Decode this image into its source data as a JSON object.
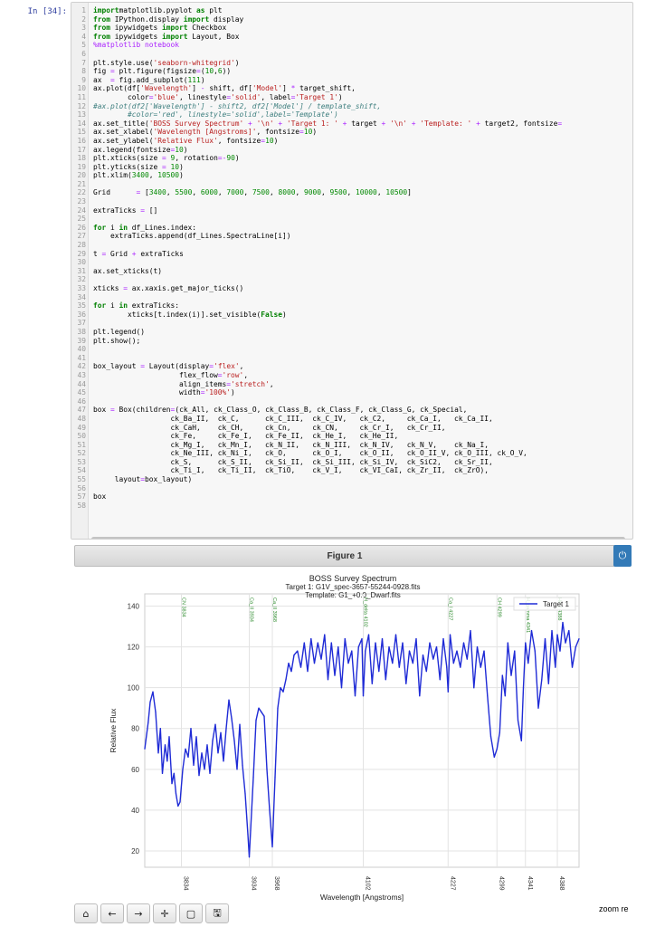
{
  "cell": {
    "prompt": "In [34]:",
    "lines": [
      [
        [
          "kw",
          "import"
        ],
        [
          "",
          "matplotlib.pyplot "
        ],
        [
          "kw",
          "as"
        ],
        [
          "",
          " plt"
        ]
      ],
      [
        [
          "kw",
          "from"
        ],
        [
          "",
          " IPython.display "
        ],
        [
          "kw",
          "import"
        ],
        [
          "",
          " display"
        ]
      ],
      [
        [
          "kw",
          "from"
        ],
        [
          "",
          " ipywidgets "
        ],
        [
          "kw",
          "import"
        ],
        [
          "",
          " Checkbox"
        ]
      ],
      [
        [
          "kw",
          "from"
        ],
        [
          "",
          " ipywidgets "
        ],
        [
          "kw",
          "import"
        ],
        [
          "",
          " Layout, Box"
        ]
      ],
      [
        [
          "op",
          "%matplotlib notebook"
        ]
      ],
      [
        [
          "",
          ""
        ]
      ],
      [
        [
          "",
          "plt.style.use("
        ],
        [
          "str",
          "'seaborn-whitegrid'"
        ],
        [
          "",
          ")"
        ]
      ],
      [
        [
          "",
          "fig "
        ],
        [
          "op",
          "="
        ],
        [
          "",
          " plt.figure(figsize"
        ],
        [
          "op",
          "="
        ],
        [
          "",
          "("
        ],
        [
          "num",
          "10"
        ],
        [
          "",
          ","
        ],
        [
          "num",
          "6"
        ],
        [
          "",
          "))"
        ]
      ],
      [
        [
          "",
          "ax  "
        ],
        [
          "op",
          "="
        ],
        [
          "",
          " fig.add_subplot("
        ],
        [
          "num",
          "111"
        ],
        [
          "",
          ")"
        ]
      ],
      [
        [
          "",
          "ax.plot(df["
        ],
        [
          "str",
          "'Wavelength'"
        ],
        [
          "",
          "] "
        ],
        [
          "op",
          "-"
        ],
        [
          "",
          " shift, df["
        ],
        [
          "str",
          "'Model'"
        ],
        [
          "",
          "] "
        ],
        [
          "op",
          "*"
        ],
        [
          "",
          " target_shift,"
        ]
      ],
      [
        [
          "",
          "        color"
        ],
        [
          "op",
          "="
        ],
        [
          "str",
          "'blue'"
        ],
        [
          "",
          ", linestyle"
        ],
        [
          "op",
          "="
        ],
        [
          "str",
          "'solid'"
        ],
        [
          "",
          ", label"
        ],
        [
          "op",
          "="
        ],
        [
          "str",
          "'Target 1'"
        ],
        [
          "",
          ")"
        ]
      ],
      [
        [
          "cm",
          "#ax.plot(df2['Wavelength'] - shift2, df2['Model'] / template_shift,"
        ]
      ],
      [
        [
          "cm",
          "        #color='red', linestyle='solid',label='Template')"
        ]
      ],
      [
        [
          "",
          "ax.set_title("
        ],
        [
          "str",
          "'BOSS Survey Spectrum'"
        ],
        [
          "",
          " "
        ],
        [
          "op",
          "+"
        ],
        [
          "",
          " "
        ],
        [
          "str",
          "'\\n'"
        ],
        [
          "",
          " "
        ],
        [
          "op",
          "+"
        ],
        [
          "",
          " "
        ],
        [
          "str",
          "'Target 1: '"
        ],
        [
          "",
          " "
        ],
        [
          "op",
          "+"
        ],
        [
          "",
          " target "
        ],
        [
          "op",
          "+"
        ],
        [
          "",
          " "
        ],
        [
          "str",
          "'\\n'"
        ],
        [
          "",
          " "
        ],
        [
          "op",
          "+"
        ],
        [
          "",
          " "
        ],
        [
          "str",
          "'Template: '"
        ],
        [
          "",
          " "
        ],
        [
          "op",
          "+"
        ],
        [
          "",
          " target2, fontsize"
        ],
        [
          "op",
          "="
        ]
      ],
      [
        [
          "",
          "ax.set_xlabel("
        ],
        [
          "str",
          "'Wavelength [Angstroms]'"
        ],
        [
          "",
          ", fontsize"
        ],
        [
          "op",
          "="
        ],
        [
          "num",
          "10"
        ],
        [
          "",
          ")"
        ]
      ],
      [
        [
          "",
          "ax.set_ylabel("
        ],
        [
          "str",
          "'Relative Flux'"
        ],
        [
          "",
          ", fontsize"
        ],
        [
          "op",
          "="
        ],
        [
          "num",
          "10"
        ],
        [
          "",
          ")"
        ]
      ],
      [
        [
          "",
          "ax.legend(fontsize"
        ],
        [
          "op",
          "="
        ],
        [
          "num",
          "10"
        ],
        [
          "",
          ")"
        ]
      ],
      [
        [
          "",
          "plt.xticks(size "
        ],
        [
          "op",
          "="
        ],
        [
          "",
          " "
        ],
        [
          "num",
          "9"
        ],
        [
          "",
          ", rotation"
        ],
        [
          "op",
          "=-"
        ],
        [
          "num",
          "90"
        ],
        [
          "",
          ")"
        ]
      ],
      [
        [
          "",
          "plt.yticks(size "
        ],
        [
          "op",
          "="
        ],
        [
          "",
          " "
        ],
        [
          "num",
          "10"
        ],
        [
          "",
          ")"
        ]
      ],
      [
        [
          "",
          "plt.xlim("
        ],
        [
          "num",
          "3400"
        ],
        [
          "",
          ", "
        ],
        [
          "num",
          "10500"
        ],
        [
          "",
          ")"
        ]
      ],
      [
        [
          "",
          ""
        ]
      ],
      [
        [
          "",
          "Grid      "
        ],
        [
          "op",
          "="
        ],
        [
          "",
          " ["
        ],
        [
          "num",
          "3400"
        ],
        [
          "",
          ", "
        ],
        [
          "num",
          "5500"
        ],
        [
          "",
          ", "
        ],
        [
          "num",
          "6000"
        ],
        [
          "",
          ", "
        ],
        [
          "num",
          "7000"
        ],
        [
          "",
          ", "
        ],
        [
          "num",
          "7500"
        ],
        [
          "",
          ", "
        ],
        [
          "num",
          "8000"
        ],
        [
          "",
          ", "
        ],
        [
          "num",
          "9000"
        ],
        [
          "",
          ", "
        ],
        [
          "num",
          "9500"
        ],
        [
          "",
          ", "
        ],
        [
          "num",
          "10000"
        ],
        [
          "",
          ", "
        ],
        [
          "num",
          "10500"
        ],
        [
          "",
          "]"
        ]
      ],
      [
        [
          "",
          ""
        ]
      ],
      [
        [
          "",
          "extraTicks "
        ],
        [
          "op",
          "="
        ],
        [
          "",
          " []"
        ]
      ],
      [
        [
          "",
          ""
        ]
      ],
      [
        [
          "kw",
          "for"
        ],
        [
          "",
          " i "
        ],
        [
          "kw",
          "in"
        ],
        [
          "",
          " df_Lines.index:"
        ]
      ],
      [
        [
          "",
          "    extraTicks.append(df_Lines.SpectraLine[i])"
        ]
      ],
      [
        [
          "",
          ""
        ]
      ],
      [
        [
          "",
          "t "
        ],
        [
          "op",
          "="
        ],
        [
          "",
          " Grid "
        ],
        [
          "op",
          "+"
        ],
        [
          "",
          " extraTicks"
        ]
      ],
      [
        [
          "",
          ""
        ]
      ],
      [
        [
          "",
          "ax.set_xticks(t)"
        ]
      ],
      [
        [
          "",
          ""
        ]
      ],
      [
        [
          "",
          "xticks "
        ],
        [
          "op",
          "="
        ],
        [
          "",
          " ax.xaxis.get_major_ticks()"
        ]
      ],
      [
        [
          "",
          ""
        ]
      ],
      [
        [
          "kw",
          "for"
        ],
        [
          "",
          " i "
        ],
        [
          "kw",
          "in"
        ],
        [
          "",
          " extraTicks:"
        ]
      ],
      [
        [
          "",
          "        xticks[t.index(i)].set_visible("
        ],
        [
          "kw",
          "False"
        ],
        [
          "",
          ")"
        ]
      ],
      [
        [
          "",
          ""
        ]
      ],
      [
        [
          "",
          "plt.legend()"
        ]
      ],
      [
        [
          "",
          "plt.show();"
        ]
      ],
      [
        [
          "",
          ""
        ]
      ],
      [
        [
          "",
          ""
        ]
      ],
      [
        [
          "",
          "box_layout "
        ],
        [
          "op",
          "="
        ],
        [
          "",
          " Layout(display"
        ],
        [
          "op",
          "="
        ],
        [
          "str",
          "'flex'"
        ],
        [
          "",
          ","
        ]
      ],
      [
        [
          "",
          "                    flex_flow"
        ],
        [
          "op",
          "="
        ],
        [
          "str",
          "'row'"
        ],
        [
          "",
          ","
        ]
      ],
      [
        [
          "",
          "                    align_items"
        ],
        [
          "op",
          "="
        ],
        [
          "str",
          "'stretch'"
        ],
        [
          "",
          ","
        ]
      ],
      [
        [
          "",
          "                    width"
        ],
        [
          "op",
          "="
        ],
        [
          "str",
          "'100%'"
        ],
        [
          "",
          ")"
        ]
      ],
      [
        [
          "",
          ""
        ]
      ],
      [
        [
          "",
          "box "
        ],
        [
          "op",
          "="
        ],
        [
          "",
          " Box(children"
        ],
        [
          "op",
          "="
        ],
        [
          "",
          "(ck_All, ck_Class_O, ck_Class_B, ck_Class_F, ck_Class_G, ck_Special,"
        ]
      ],
      [
        [
          "",
          "                  ck_Ba_II,  ck_C,      ck_C_III,  ck_C_IV,   ck_C2,     ck_Ca_I,   ck_Ca_II,"
        ]
      ],
      [
        [
          "",
          "                  ck_CaH,    ck_CH,     ck_Cn,     ck_CN,     ck_Cr_I,   ck_Cr_II,"
        ]
      ],
      [
        [
          "",
          "                  ck_Fe,     ck_Fe_I,   ck_Fe_II,  ck_He_I,   ck_He_II,"
        ]
      ],
      [
        [
          "",
          "                  ck_Mg_I,   ck_Mn_I,   ck_N_II,   ck_N_III,  ck_N_IV,   ck_N_V,    ck_Na_I,"
        ]
      ],
      [
        [
          "",
          "                  ck_Ne_III, ck_Ni_I,   ck_O,      ck_O_I,    ck_O_II,   ck_O_II_V, ck_O_III, ck_O_V,"
        ]
      ],
      [
        [
          "",
          "                  ck_S,      ck_S_II,   ck_Si_II,  ck_Si_III, ck_Si_IV,  ck_SiC2,   ck_Sr_II,"
        ]
      ],
      [
        [
          "",
          "                  ck_Ti_I,   ck_Ti_II,  ck_TiO,    ck_V_I,    ck_VI_CaI, ck_Zr_II,  ck_ZrO),"
        ]
      ],
      [
        [
          "",
          "     layout"
        ],
        [
          "op",
          "="
        ],
        [
          "",
          "box_layout)"
        ]
      ],
      [
        [
          "",
          ""
        ]
      ],
      [
        [
          "",
          "box"
        ]
      ],
      [
        [
          "",
          ""
        ]
      ]
    ]
  },
  "figure": {
    "header": "Figure 1",
    "power_icon": "power-icon"
  },
  "chart_data": {
    "type": "line",
    "title": "BOSS Survey Spectrum",
    "subtitle_lines": [
      "Target 1: G1V_spec-3657-55244-0928.fits",
      "Template: G1_+0.0_Dwarf.fits"
    ],
    "xlabel": "Wavelength [Angstroms]",
    "ylabel": "Relative Flux",
    "xlim": [
      3780,
      4420
    ],
    "ylim": [
      12,
      146
    ],
    "yticks": [
      20,
      40,
      60,
      80,
      100,
      120,
      140
    ],
    "xtick_labels": [
      {
        "x": 3834,
        "label": "3834"
      },
      {
        "x": 3934,
        "label": "3934"
      },
      {
        "x": 3968,
        "label": "3968"
      },
      {
        "x": 4102,
        "label": "4102"
      },
      {
        "x": 4227,
        "label": "4227"
      },
      {
        "x": 4299,
        "label": "4299"
      },
      {
        "x": 4341,
        "label": "4341"
      },
      {
        "x": 4388,
        "label": "4388"
      }
    ],
    "line_markers": [
      {
        "x": 3834,
        "label": "CN 3834"
      },
      {
        "x": 3934,
        "label": "Ca_II 3934"
      },
      {
        "x": 3968,
        "label": "Ca_II 3968"
      },
      {
        "x": 4102,
        "label": "H_delta 4102"
      },
      {
        "x": 4227,
        "label": "Ca_I 4227"
      },
      {
        "x": 4299,
        "label": "CH 4299"
      },
      {
        "x": 4341,
        "label": "H_gamma 4341"
      },
      {
        "x": 4388,
        "label": "He_I 4388"
      }
    ],
    "grid": true,
    "legend_position": "top-right",
    "colors": {
      "series": "#1f2bd6",
      "markers": "#2e8b2e"
    },
    "series": [
      {
        "name": "Target 1",
        "x": [
          3780,
          3785,
          3788,
          3792,
          3796,
          3800,
          3803,
          3806,
          3810,
          3813,
          3816,
          3820,
          3823,
          3826,
          3829,
          3832,
          3836,
          3840,
          3844,
          3848,
          3852,
          3856,
          3860,
          3864,
          3868,
          3872,
          3876,
          3880,
          3884,
          3888,
          3892,
          3896,
          3900,
          3904,
          3908,
          3912,
          3916,
          3920,
          3924,
          3928,
          3932,
          3934,
          3936,
          3940,
          3944,
          3948,
          3952,
          3956,
          3960,
          3964,
          3968,
          3972,
          3976,
          3980,
          3984,
          3988,
          3992,
          3996,
          4000,
          4005,
          4010,
          4015,
          4020,
          4025,
          4030,
          4035,
          4040,
          4045,
          4050,
          4055,
          4060,
          4065,
          4070,
          4075,
          4080,
          4085,
          4090,
          4095,
          4100,
          4102,
          4105,
          4110,
          4115,
          4120,
          4125,
          4130,
          4135,
          4140,
          4145,
          4150,
          4155,
          4160,
          4165,
          4170,
          4175,
          4180,
          4185,
          4190,
          4195,
          4200,
          4205,
          4210,
          4215,
          4220,
          4225,
          4227,
          4230,
          4235,
          4240,
          4245,
          4250,
          4255,
          4260,
          4265,
          4270,
          4275,
          4280,
          4285,
          4290,
          4295,
          4299,
          4303,
          4307,
          4311,
          4315,
          4320,
          4325,
          4330,
          4335,
          4338,
          4341,
          4345,
          4350,
          4355,
          4360,
          4365,
          4370,
          4375,
          4380,
          4385,
          4388,
          4392,
          4396,
          4400,
          4405,
          4410,
          4415,
          4420
        ],
        "values": [
          70,
          83,
          93,
          98,
          88,
          68,
          80,
          58,
          72,
          64,
          76,
          53,
          58,
          48,
          42,
          44,
          60,
          70,
          66,
          80,
          62,
          76,
          57,
          68,
          60,
          72,
          58,
          74,
          82,
          68,
          78,
          64,
          80,
          94,
          85,
          74,
          60,
          82,
          62,
          48,
          28,
          17,
          30,
          56,
          84,
          90,
          88,
          86,
          60,
          40,
          22,
          56,
          90,
          100,
          98,
          104,
          112,
          108,
          116,
          118,
          110,
          122,
          108,
          124,
          112,
          122,
          114,
          126,
          104,
          122,
          106,
          120,
          100,
          124,
          112,
          118,
          96,
          120,
          124,
          96,
          118,
          126,
          102,
          122,
          108,
          124,
          104,
          120,
          112,
          126,
          110,
          122,
          102,
          118,
          112,
          124,
          96,
          116,
          108,
          122,
          114,
          120,
          104,
          124,
          110,
          98,
          126,
          112,
          118,
          110,
          122,
          114,
          128,
          100,
          120,
          110,
          118,
          96,
          76,
          66,
          70,
          78,
          106,
          96,
          122,
          106,
          118,
          84,
          74,
          100,
          122,
          112,
          128,
          118,
          90,
          104,
          124,
          102,
          128,
          110,
          126,
          118,
          132,
          122,
          128,
          110,
          120,
          124
        ]
      }
    ]
  },
  "toolbar": {
    "buttons": [
      "home-icon",
      "back-icon",
      "forward-icon",
      "pan-icon",
      "zoom-rect-icon",
      "save-icon"
    ],
    "status": "zoom re"
  }
}
